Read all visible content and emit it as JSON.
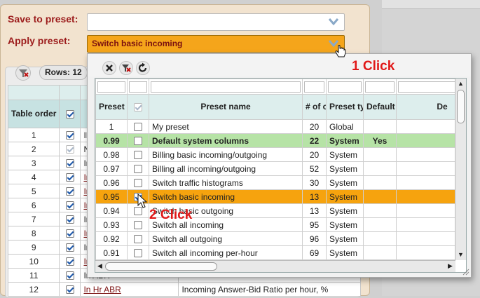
{
  "form": {
    "save_label": "Save to preset:",
    "save_value": "",
    "apply_label": "Apply preset:",
    "apply_value": "Switch basic incoming"
  },
  "toolbar": {
    "rows_label": "Rows: 12"
  },
  "bg_table": {
    "header": [
      "Table order"
    ],
    "rows": [
      {
        "order": "1",
        "checked": true,
        "disabled": false,
        "name": "ID",
        "link": false,
        "desc": ""
      },
      {
        "order": "2",
        "checked": true,
        "disabled": true,
        "name": "NAME",
        "link": false,
        "desc": ""
      },
      {
        "order": "3",
        "checked": true,
        "disabled": false,
        "name": "In Calls",
        "link": false,
        "desc": ""
      },
      {
        "order": "4",
        "checked": true,
        "disabled": false,
        "name": "In Hr AT",
        "link": true,
        "desc": ""
      },
      {
        "order": "5",
        "checked": true,
        "disabled": false,
        "name": "In Hr C",
        "link": true,
        "desc": ""
      },
      {
        "order": "6",
        "checked": true,
        "disabled": false,
        "name": "In Hr M",
        "link": true,
        "desc": ""
      },
      {
        "order": "7",
        "checked": true,
        "disabled": false,
        "name": "In ACD",
        "link": false,
        "desc": ""
      },
      {
        "order": "8",
        "checked": true,
        "disabled": false,
        "name": "In Hr AC",
        "link": true,
        "desc": ""
      },
      {
        "order": "9",
        "checked": true,
        "disabled": false,
        "name": "In ASR",
        "link": false,
        "desc": ""
      },
      {
        "order": "10",
        "checked": true,
        "disabled": false,
        "name": "In Hr AS",
        "link": true,
        "desc": ""
      },
      {
        "order": "11",
        "checked": true,
        "disabled": false,
        "name": "In ABR",
        "link": false,
        "desc": ""
      },
      {
        "order": "12",
        "checked": true,
        "disabled": false,
        "name": "In Hr ABR",
        "link": true,
        "desc": "Incoming Answer-Bid Ratio per hour, %"
      }
    ]
  },
  "popup": {
    "headers": {
      "id": "Preset ID",
      "name": "Preset name",
      "cols": "# of cols",
      "type": "Preset type",
      "default": "Default preset",
      "desc": "De"
    },
    "rows": [
      {
        "id": "1",
        "checked": false,
        "name": "My preset",
        "cols": "20",
        "type": "Global",
        "default": "",
        "style": ""
      },
      {
        "id": "0.99",
        "checked": false,
        "name": "Default system columns",
        "cols": "22",
        "type": "System",
        "default": "Yes",
        "style": "sys-row"
      },
      {
        "id": "0.98",
        "checked": false,
        "name": "Billing basic incoming/outgoing",
        "cols": "20",
        "type": "System",
        "default": "",
        "style": ""
      },
      {
        "id": "0.97",
        "checked": false,
        "name": "Billing all incoming/outgoing",
        "cols": "52",
        "type": "System",
        "default": "",
        "style": ""
      },
      {
        "id": "0.96",
        "checked": false,
        "name": "Switch traffic histograms",
        "cols": "30",
        "type": "System",
        "default": "",
        "style": ""
      },
      {
        "id": "0.95",
        "checked": true,
        "name": "Switch basic incoming",
        "cols": "13",
        "type": "System",
        "default": "",
        "style": "selected"
      },
      {
        "id": "0.94",
        "checked": false,
        "name": "Switch basic outgoing",
        "cols": "13",
        "type": "System",
        "default": "",
        "style": ""
      },
      {
        "id": "0.93",
        "checked": false,
        "name": "Switch all incoming",
        "cols": "95",
        "type": "System",
        "default": "",
        "style": ""
      },
      {
        "id": "0.92",
        "checked": false,
        "name": "Switch all outgoing",
        "cols": "96",
        "type": "System",
        "default": "",
        "style": ""
      },
      {
        "id": "0.91",
        "checked": false,
        "name": "Switch all incoming per-hour",
        "cols": "69",
        "type": "System",
        "default": "",
        "style": ""
      }
    ]
  },
  "annotations": {
    "step1": "1 Click",
    "step2": "2 Click"
  },
  "colors": {
    "accent": "#f5a51b",
    "annotation": "#e01818",
    "system_row": "#b6e3a6",
    "header": "#ddeeed"
  },
  "icons": [
    "chevron-down-icon",
    "filter-clear-icon",
    "close-icon",
    "refresh-icon",
    "resize-grip-icon",
    "hand-cursor-icon",
    "arrow-cursor-icon"
  ]
}
